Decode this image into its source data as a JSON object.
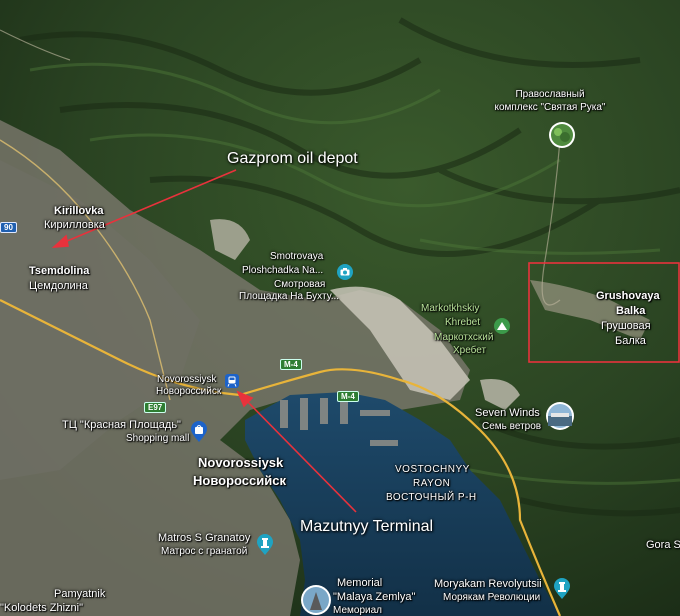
{
  "annotations": {
    "gazprom": "Gazprom oil depot",
    "mazutnyy": "Mazutnyy Terminal"
  },
  "places": {
    "kirillovka_en": "Kirillovka",
    "kirillovka_ru": "Кирилловка",
    "tsemdolina_en": "Tsemdolina",
    "tsemdolina_ru": "Цемдолина",
    "novorossiysk_small_en": "Novorossiysk",
    "novorossiysk_small_ru": "Новороссийск",
    "novorossiysk_big_en": "Novorossiysk",
    "novorossiysk_big_ru": "Новороссийск",
    "vostochnyy_en1": "VOSTOCHNYY",
    "vostochnyy_en2": "RAYON",
    "vostochnyy_ru": "ВОСТОЧНЫЙ Р-Н",
    "grushovaya_en1": "Grushovaya",
    "grushovaya_en2": "Balka",
    "grushovaya_ru1": "Грушовая",
    "grushovaya_ru2": "Балка",
    "gora": "Gora S"
  },
  "pois": {
    "svyataya_line1": "Православный",
    "svyataya_line2": "комплекс \"Святая Рука\"",
    "smotrovaya_en1": "Smotrovaya",
    "smotrovaya_en2": "Ploshchadka Na...",
    "smotrovaya_ru1": "Смотровая",
    "smotrovaya_ru2": "Площадка На Бухту...",
    "markotkh_en1": "Markotkhskiy",
    "markotkh_en2": "Khrebet",
    "markotkh_ru1": "Маркотхский",
    "markotkh_ru2": "Хребет",
    "seven_en": "Seven Winds",
    "seven_ru": "Семь ветров",
    "tc_name": "ТЦ \"Красная Площадь\"",
    "tc_type": "Shopping mall",
    "matros_en": "Matros S Granatoy",
    "matros_ru": "Матрос с гранатой",
    "memorial_en1": "Memorial",
    "memorial_en2": "\"Malaya Zemlya\"",
    "memorial_ru": "Мемориал",
    "moryakam_en": "Moryakam Revolyutsii",
    "moryakam_ru": "Морякам Революции",
    "pamyatnik_en1": "Pamyatnik",
    "pamyatnik_en2": "\"Kolodets Zhizni\""
  },
  "roads": {
    "m4_a": "M-4",
    "m4_b": "M-4",
    "e97": "E97",
    "edge_num": "90"
  },
  "colors": {
    "annotation_red": "#e8323c",
    "water": "#16395a",
    "forest": "#2b4324"
  },
  "icons": {
    "poi_camera": "camera-icon",
    "poi_mountain": "mountain-icon",
    "poi_monument": "monument-icon",
    "poi_mall": "shopping-bag-icon",
    "poi_station": "train-icon",
    "poi_photo": "photo-thumbnail-icon"
  }
}
